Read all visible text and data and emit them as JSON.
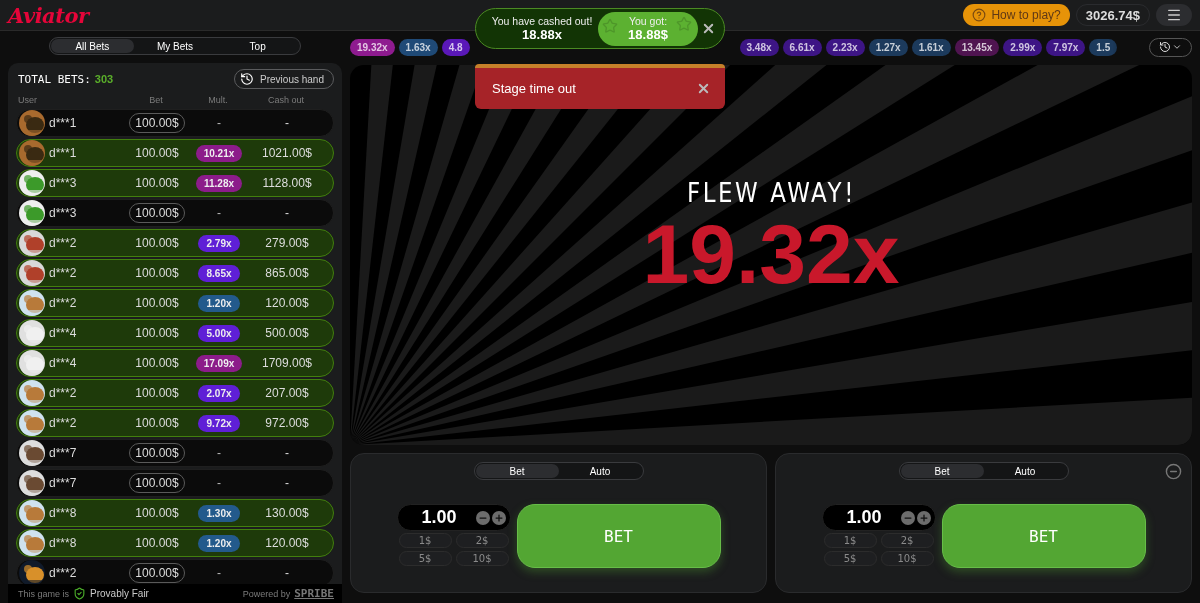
{
  "header": {
    "logo": "Aviator",
    "how_to_play": "How to play?",
    "balance": "3026.74",
    "currency": "$"
  },
  "bets_tabs": [
    {
      "label": "All Bets",
      "selected": true
    },
    {
      "label": "My Bets",
      "selected": false
    },
    {
      "label": "Top",
      "selected": false
    }
  ],
  "bets_panel": {
    "total_label": "TOTAL BETS:",
    "total": "303",
    "previous_hand": "Previous hand",
    "columns": [
      "User",
      "Bet",
      "Mult.",
      "Cash out"
    ],
    "rows": [
      {
        "user": "d***1",
        "bet": "100.00$",
        "cashed_out": false,
        "mult": "-",
        "cash_out": "-"
      },
      {
        "user": "d***1",
        "bet": "100.00$",
        "cashed_out": true,
        "mult": "10.21x",
        "color": "#8c1c8a",
        "cash_out": "1021.00$"
      },
      {
        "user": "d***3",
        "bet": "100.00$",
        "cashed_out": true,
        "mult": "11.28x",
        "color": "#8c1c8a",
        "cash_out": "1128.00$"
      },
      {
        "user": "d***3",
        "bet": "100.00$",
        "cashed_out": false,
        "mult": "-",
        "cash_out": "-"
      },
      {
        "user": "d***2",
        "bet": "100.00$",
        "cashed_out": true,
        "mult": "2.79x",
        "color": "#5f1fd6",
        "cash_out": "279.00$"
      },
      {
        "user": "d***2",
        "bet": "100.00$",
        "cashed_out": true,
        "mult": "8.65x",
        "color": "#5f1fd6",
        "cash_out": "865.00$"
      },
      {
        "user": "d***2",
        "bet": "100.00$",
        "cashed_out": true,
        "mult": "1.20x",
        "color": "#235a8c",
        "cash_out": "120.00$"
      },
      {
        "user": "d***4",
        "bet": "100.00$",
        "cashed_out": true,
        "mult": "5.00x",
        "color": "#5f1fd6",
        "cash_out": "500.00$"
      },
      {
        "user": "d***4",
        "bet": "100.00$",
        "cashed_out": true,
        "mult": "17.09x",
        "color": "#8c1c8a",
        "cash_out": "1709.00$"
      },
      {
        "user": "d***2",
        "bet": "100.00$",
        "cashed_out": true,
        "mult": "2.07x",
        "color": "#5f1fd6",
        "cash_out": "207.00$"
      },
      {
        "user": "d***2",
        "bet": "100.00$",
        "cashed_out": true,
        "mult": "9.72x",
        "color": "#5f1fd6",
        "cash_out": "972.00$"
      },
      {
        "user": "d***7",
        "bet": "100.00$",
        "cashed_out": false,
        "mult": "-",
        "cash_out": "-"
      },
      {
        "user": "d***7",
        "bet": "100.00$",
        "cashed_out": false,
        "mult": "-",
        "cash_out": "-"
      },
      {
        "user": "d***8",
        "bet": "100.00$",
        "cashed_out": true,
        "mult": "1.30x",
        "color": "#235a8c",
        "cash_out": "130.00$"
      },
      {
        "user": "d***8",
        "bet": "100.00$",
        "cashed_out": true,
        "mult": "1.20x",
        "color": "#235a8c",
        "cash_out": "120.00$"
      },
      {
        "user": "d***2",
        "bet": "100.00$",
        "cashed_out": false,
        "mult": "-",
        "cash_out": "-"
      }
    ],
    "footer": {
      "prefix": "This game is",
      "fair": "Provably Fair",
      "powered": "Powered by",
      "brand": "SPRIBE"
    }
  },
  "multiplier_history": {
    "before_overlay": [
      {
        "label": "19.32x",
        "color": "#8e1b8f"
      },
      {
        "label": "1.63x",
        "color": "#1f4a77"
      },
      {
        "label": "4.8",
        "color": "#5a18b8"
      }
    ],
    "after_overlay": [
      {
        "label": "3.48x",
        "color": "#3d1585"
      },
      {
        "label": "6.61x",
        "color": "#3d1585"
      },
      {
        "label": "2.23x",
        "color": "#3d1585"
      },
      {
        "label": "1.27x",
        "color": "#1c3a5c"
      },
      {
        "label": "1.61x",
        "color": "#1c3a5c"
      },
      {
        "label": "13.45x",
        "color": "#4f1450"
      },
      {
        "label": "2.99x",
        "color": "#3d1585"
      },
      {
        "label": "7.97x",
        "color": "#3d1585"
      },
      {
        "label": "1.5",
        "color": "#1c3a5c"
      }
    ]
  },
  "game": {
    "status": "FLEW AWAY!",
    "multiplier": "19.32x"
  },
  "cashout_toast": {
    "title": "You have cashed out!",
    "multiplier": "18.88x",
    "win_label": "You got:",
    "win_amount": "18.88$"
  },
  "error_toast": {
    "message": "Stage time out"
  },
  "bet_panels": [
    {
      "tabs": [
        {
          "label": "Bet",
          "selected": true
        },
        {
          "label": "Auto",
          "selected": false
        }
      ],
      "amount": "1.00",
      "quick": [
        "1$",
        "2$",
        "5$",
        "10$"
      ],
      "button": "BET"
    },
    {
      "tabs": [
        {
          "label": "Bet",
          "selected": true
        },
        {
          "label": "Auto",
          "selected": false
        }
      ],
      "amount": "1.00",
      "quick": [
        "1$",
        "2$",
        "5$",
        "10$"
      ],
      "button": "BET",
      "removable": true
    }
  ]
}
